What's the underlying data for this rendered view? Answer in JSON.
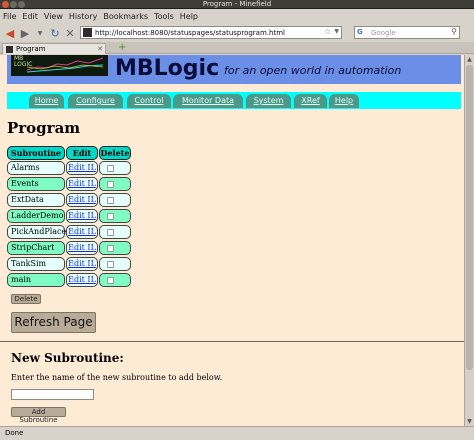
{
  "window": {
    "title": "Program - Minefield"
  },
  "menu": [
    "File",
    "Edit",
    "View",
    "History",
    "Bookmarks",
    "Tools",
    "Help"
  ],
  "toolbar": {
    "url": "http://localhost:8080/statuspages/statusprogram.html",
    "search_engine_label": "G",
    "search_placeholder": "Google"
  },
  "tab": {
    "label": "Program"
  },
  "banner": {
    "logo_text": "MB LOGIC",
    "brand": "MBLogic",
    "tagline": "for an open world in automation"
  },
  "nav": [
    "Home",
    "Configure",
    "Control",
    "Monitor Data",
    "System",
    "XRef",
    "Help"
  ],
  "page": {
    "title": "Program",
    "columns": [
      "Subroutine",
      "Edit IL",
      "Delete"
    ],
    "rows": [
      {
        "name": "Alarms",
        "edit": "Edit IL",
        "delete": false
      },
      {
        "name": "Events",
        "edit": "Edit IL",
        "delete": false
      },
      {
        "name": "ExtData",
        "edit": "Edit IL",
        "delete": false
      },
      {
        "name": "LadderDemo",
        "edit": "Edit IL",
        "delete": false
      },
      {
        "name": "PickAndPlace",
        "edit": "Edit IL",
        "delete": false
      },
      {
        "name": "StripChart",
        "edit": "Edit IL",
        "delete": false
      },
      {
        "name": "TankSim",
        "edit": "Edit IL",
        "delete": false
      },
      {
        "name": "main",
        "edit": "Edit IL",
        "delete": false
      }
    ],
    "delete_button": "Delete",
    "refresh_button": "Refresh Page",
    "new_subroutine_title": "New Subroutine:",
    "new_subroutine_prompt": "Enter the name of the new subroutine to add below.",
    "new_subroutine_value": "",
    "add_button": "Add Subroutine"
  },
  "status": {
    "text": "Done"
  },
  "colors": {
    "page_bg": "#fdebd6",
    "banner_bg": "#6b8ee6",
    "nav_strip": "#00ffff",
    "nav_tab": "#4a9a8a",
    "header_cell": "#00d8c8",
    "row_light": "#e6ffff",
    "row_green": "#7efcc4",
    "link": "#1a2bd0",
    "button": "#b8ac99"
  }
}
